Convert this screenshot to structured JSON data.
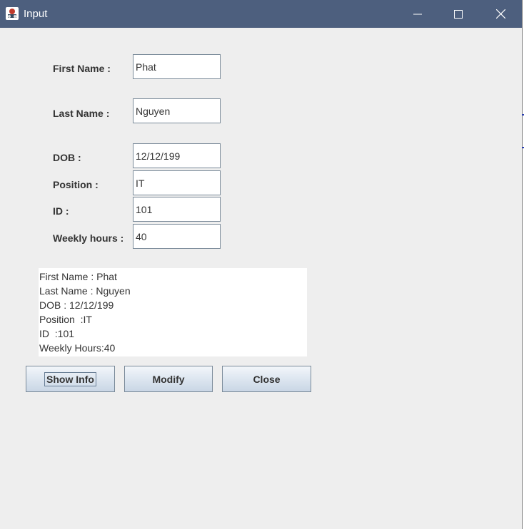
{
  "window": {
    "title": "Input",
    "controls": {
      "minimize_icon": "minimize-icon",
      "maximize_icon": "maximize-icon",
      "close_icon": "close-icon"
    }
  },
  "form": {
    "first_name": {
      "label": "First Name :",
      "value": "Phat"
    },
    "last_name": {
      "label": "Last Name :",
      "value": "Nguyen"
    },
    "dob": {
      "label": "DOB :",
      "value": "12/12/199"
    },
    "position": {
      "label": "Position :",
      "value": "IT"
    },
    "id": {
      "label": "ID :",
      "value": "101"
    },
    "weekly_hours": {
      "label": "Weekly hours :",
      "value": "40"
    }
  },
  "info": {
    "lines": [
      "First Name : Phat",
      "Last Name : Nguyen",
      "DOB : 12/12/199",
      "Position  :IT",
      "ID  :101",
      "Weekly Hours:40"
    ]
  },
  "buttons": {
    "show_info": "Show Info",
    "modify": "Modify",
    "close": "Close"
  },
  "colors": {
    "titlebar": "#4d5f7e",
    "window_bg": "#eeeeee",
    "field_border": "#7a8a99"
  }
}
